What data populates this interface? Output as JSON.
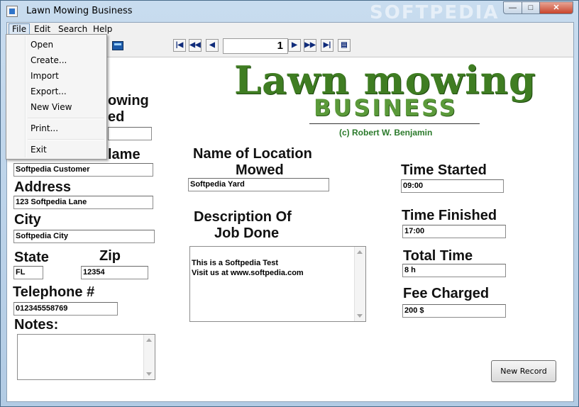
{
  "window": {
    "title": "Lawn Mowing Business",
    "watermark": "SOFTPEDIA",
    "min_glyph": "—",
    "max_glyph": "□",
    "close_glyph": "✕"
  },
  "menubar": [
    "File",
    "Edit",
    "Search",
    "Help"
  ],
  "file_menu": {
    "items": [
      "Open",
      "Create...",
      "Import",
      "Export...",
      "New View",
      "Print...",
      "Exit"
    ]
  },
  "toolbar": {
    "first": "|◀",
    "prev_page": "◀◀",
    "prev": "◀",
    "record_number": "1",
    "next": "▶",
    "next_page": "▶▶",
    "last": "▶|",
    "props": "▤"
  },
  "logo": {
    "line1": "Lawn mowing",
    "line2": "BUSINESS",
    "copyright": "(c) Robert W. Benjamin"
  },
  "form": {
    "lawn_mowing_label_part1": "owing",
    "lawn_mowing_label_part2": "ed",
    "lawn_mowing_value": "",
    "name_label": "lame",
    "name_value": "Softpedia Customer",
    "address_label": "Address",
    "address_value": "123 Softpedia Lane",
    "city_label": "City",
    "city_value": "Softpedia City",
    "state_label": "State",
    "state_value": "FL",
    "zip_label": "Zip",
    "zip_value": "12354",
    "telephone_label": "Telephone #",
    "telephone_value": "012345558769",
    "notes_label": "Notes:",
    "notes_value": "",
    "location_label_1": "Name of Location",
    "location_label_2": "Mowed",
    "location_value": "Softpedia Yard",
    "description_label_1": "Description Of",
    "description_label_2": "Job Done",
    "description_value": "This is a Softpedia Test\nVisit us at www.softpedia.com",
    "time_started_label": "Time Started",
    "time_started_value": "09:00",
    "time_finished_label": "Time Finished",
    "time_finished_value": "17:00",
    "total_time_label": "Total Time",
    "total_time_value": "8 h",
    "fee_label": "Fee Charged",
    "fee_value": "200 $"
  },
  "buttons": {
    "new_record": "New Record"
  }
}
